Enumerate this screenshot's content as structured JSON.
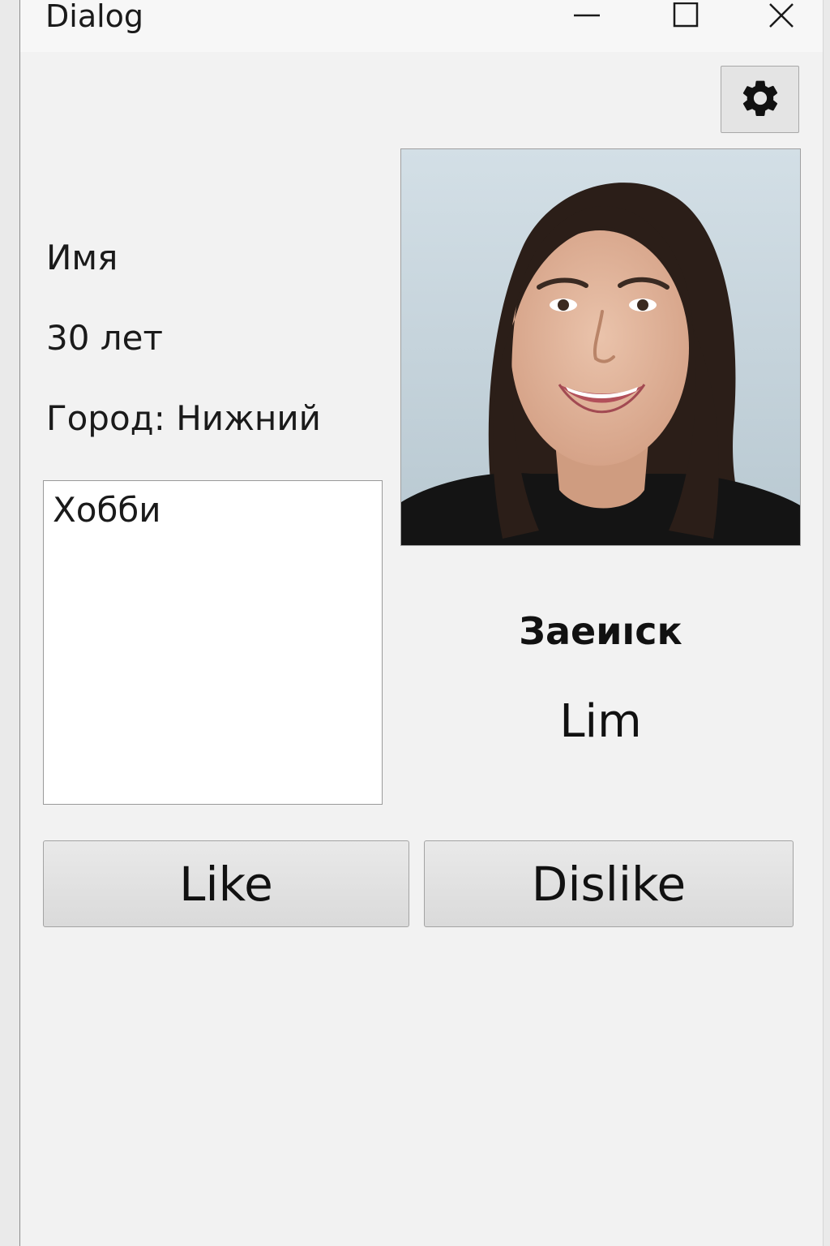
{
  "window": {
    "title": "Dialog",
    "minimize_icon": "minimize-icon",
    "maximize_icon": "maximize-icon",
    "close_icon": "close-icon"
  },
  "toolbar": {
    "settings_icon": "gear-icon"
  },
  "profile": {
    "name": "Имя",
    "age": "30 лет",
    "city": "Город: Нижний",
    "hobbies": "Хобби",
    "status": "Заеиıск",
    "name_caption": "Lim",
    "photo": "profile-photo"
  },
  "actions": {
    "like_label": "Like",
    "dislike_label": "Dislike"
  },
  "colors": {
    "window_bg": "#f2f2f2",
    "titlebar_bg": "#f7f7f7",
    "button_bg": "#e0e0e0",
    "text": "#1a1a1a"
  }
}
